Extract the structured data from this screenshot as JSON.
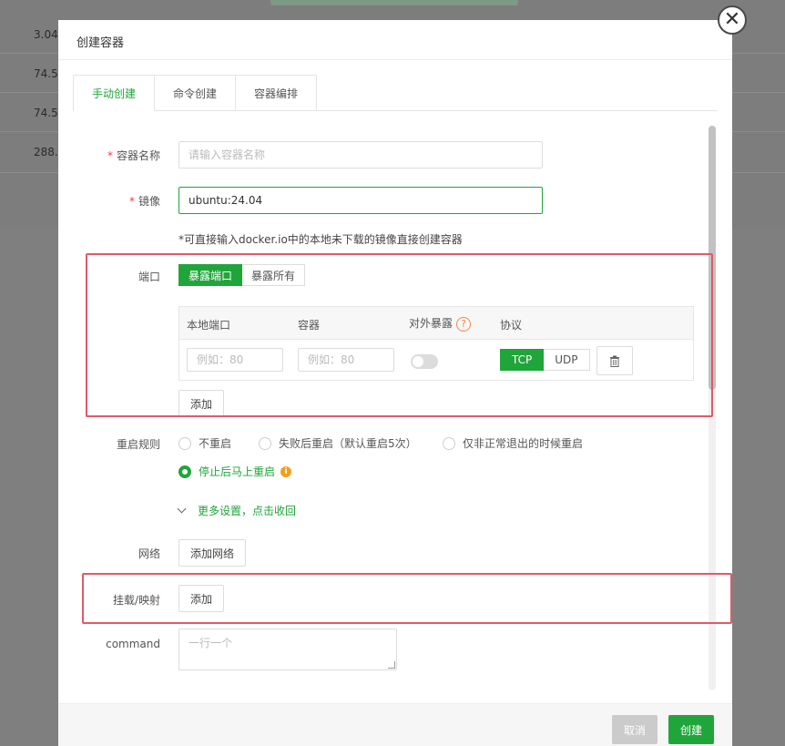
{
  "background": {
    "rows": [
      "3.04",
      "74.5",
      "74.5",
      "288.5"
    ]
  },
  "modal": {
    "title": "创建容器",
    "tabs": [
      {
        "label": "手动创建",
        "active": true
      },
      {
        "label": "命令创建",
        "active": false
      },
      {
        "label": "容器编排",
        "active": false
      }
    ]
  },
  "form": {
    "name": {
      "label": "容器名称",
      "placeholder": "请输入容器名称",
      "value": ""
    },
    "image": {
      "label": "镜像",
      "value": "ubuntu:24.04"
    },
    "image_hint": "*可直接输入docker.io中的本地未下载的镜像直接创建容器",
    "port": {
      "label": "端口",
      "mode_options": [
        "暴露端口",
        "暴露所有"
      ],
      "mode_selected": "暴露端口",
      "columns": [
        "本地端口",
        "容器",
        "对外暴露",
        "协议"
      ],
      "row": {
        "local_placeholder": "例如：80",
        "container_placeholder": "例如：80",
        "expose": false,
        "protocols": [
          "TCP",
          "UDP"
        ],
        "protocol_selected": "TCP"
      },
      "add_label": "添加"
    },
    "restart": {
      "label": "重启规则",
      "options": [
        "不重启",
        "失败后重启（默认重启5次）",
        "仅非正常退出的时候重启",
        "停止后马上重启"
      ],
      "selected": "停止后马上重启"
    },
    "more_settings": "更多设置，点击收回",
    "network": {
      "label": "网络",
      "button": "添加网络"
    },
    "mount": {
      "label": "挂载/映射",
      "button": "添加"
    },
    "command": {
      "label": "command",
      "placeholder": "一行一个"
    }
  },
  "footer": {
    "cancel": "取消",
    "create": "创建"
  },
  "colors": {
    "accent": "#20a53a",
    "highlight": "#e05a6a",
    "required": "#ef3d3d"
  }
}
